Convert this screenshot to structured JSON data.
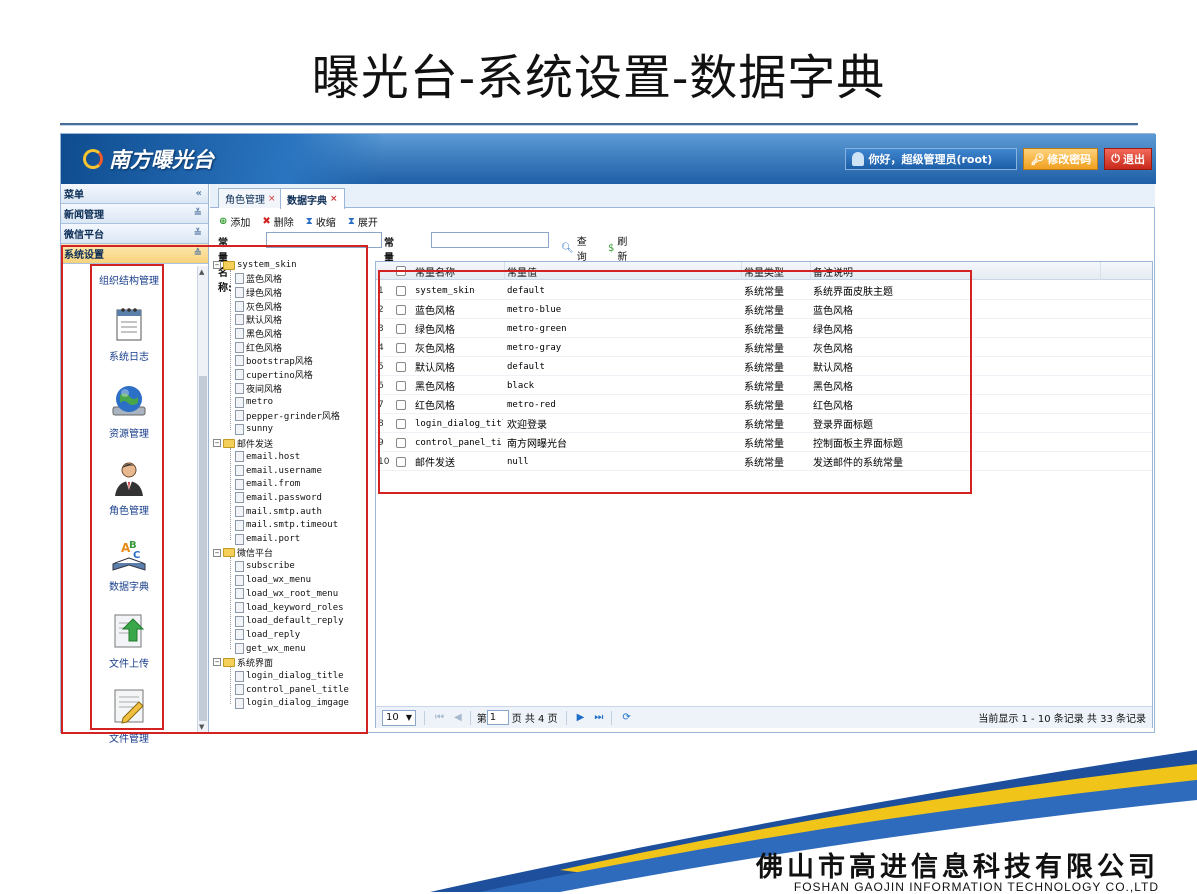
{
  "slide": {
    "title": "曝光台-系统设置-数据字典",
    "company_cn": "佛山市高进信息科技有限公司",
    "company_en": "FOSHAN GAOJIN INFORMATION TECHNOLOGY CO.,LTD"
  },
  "app": {
    "logo_text": "南方曝光台",
    "greeting": "你好，超级管理员(root)",
    "change_password": "修改密码",
    "logout": "退出"
  },
  "sidebar": {
    "menu_title": "菜单",
    "groups": [
      "新闻管理",
      "微信平台",
      "系统设置"
    ],
    "items": [
      {
        "label": "组织结构管理",
        "icon": "org-structure-icon"
      },
      {
        "label": "系统日志",
        "icon": "notepad-icon"
      },
      {
        "label": "资源管理",
        "icon": "globe-icon"
      },
      {
        "label": "角色管理",
        "icon": "user-icon"
      },
      {
        "label": "数据字典",
        "icon": "book-icon"
      },
      {
        "label": "文件上传",
        "icon": "upload-icon"
      },
      {
        "label": "文件管理",
        "icon": "file-edit-icon"
      }
    ]
  },
  "tabs": [
    {
      "label": "角色管理"
    },
    {
      "label": "数据字典"
    }
  ],
  "toolbar": {
    "add": "添加",
    "delete": "删除",
    "collapse": "收缩",
    "expand": "展开"
  },
  "search": {
    "name_label": "常量名称:",
    "name_value": "",
    "content_label": "常量内容:",
    "content_value": "",
    "query": "查询",
    "refresh": "刷新"
  },
  "tree": {
    "groups": [
      {
        "label": "system_skin",
        "children": [
          "蓝色风格",
          "绿色风格",
          "灰色风格",
          "默认风格",
          "黑色风格",
          "红色风格",
          "bootstrap风格",
          "cupertino风格",
          "夜间风格",
          "metro",
          "pepper-grinder风格",
          "sunny"
        ]
      },
      {
        "label": "邮件发送",
        "children": [
          "email.host",
          "email.username",
          "email.from",
          "email.password",
          "mail.smtp.auth",
          "mail.smtp.timeout",
          "email.port"
        ]
      },
      {
        "label": "微信平台",
        "children": [
          "subscribe",
          "load_wx_menu",
          "load_wx_root_menu",
          "load_keyword_roles",
          "load_default_reply",
          "load_reply",
          "get_wx_menu"
        ]
      },
      {
        "label": "系统界面",
        "children": [
          "login_dialog_title",
          "control_panel_title",
          "login_dialog_imgage"
        ]
      }
    ]
  },
  "table": {
    "columns": [
      "常量名称",
      "常量值",
      "常量类型",
      "备注说明"
    ],
    "rows": [
      {
        "num": "1",
        "name": "system_skin",
        "value": "default",
        "type": "系统常量",
        "note": "系统界面皮肤主题"
      },
      {
        "num": "2",
        "name": "蓝色风格",
        "value": "metro-blue",
        "type": "系统常量",
        "note": "蓝色风格"
      },
      {
        "num": "3",
        "name": "绿色风格",
        "value": "metro-green",
        "type": "系统常量",
        "note": "绿色风格"
      },
      {
        "num": "4",
        "name": "灰色风格",
        "value": "metro-gray",
        "type": "系统常量",
        "note": "灰色风格"
      },
      {
        "num": "5",
        "name": "默认风格",
        "value": "default",
        "type": "系统常量",
        "note": "默认风格"
      },
      {
        "num": "6",
        "name": "黑色风格",
        "value": "black",
        "type": "系统常量",
        "note": "黑色风格"
      },
      {
        "num": "7",
        "name": "红色风格",
        "value": "metro-red",
        "type": "系统常量",
        "note": "红色风格"
      },
      {
        "num": "8",
        "name": "login_dialog_titl",
        "value": "欢迎登录",
        "type": "系统常量",
        "note": "登录界面标题"
      },
      {
        "num": "9",
        "name": "control_panel_ti",
        "value": "南方网曝光台",
        "type": "系统常量",
        "note": "控制面板主界面标题"
      },
      {
        "num": "10",
        "name": "邮件发送",
        "value": "null",
        "type": "系统常量",
        "note": "发送邮件的系统常量"
      }
    ]
  },
  "pager": {
    "page_size": "10",
    "page_prefix": "第",
    "page_value": "1",
    "page_suffix": "页 共 4 页",
    "summary": "当前显示 1 - 10 条记录 共 33 条记录"
  },
  "colors": {
    "header_blue": "#1f5fa6",
    "highlight_red": "#d32222",
    "link_blue": "#1a3f8c"
  }
}
